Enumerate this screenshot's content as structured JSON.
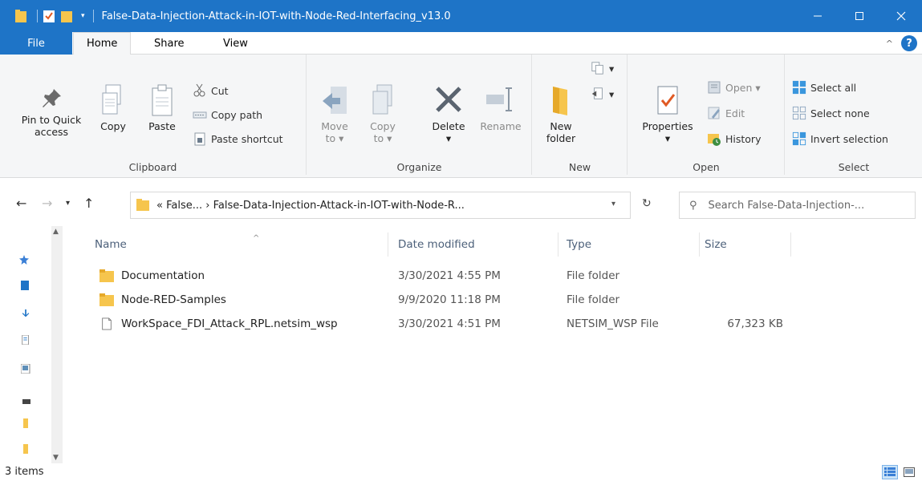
{
  "window": {
    "title": "False-Data-Injection-Attack-in-IOT-with-Node-Red-Interfacing_v13.0",
    "minimize": "—",
    "maximize": "☐",
    "close": "✕"
  },
  "ribbon_tabs": {
    "file": "File",
    "home": "Home",
    "share": "Share",
    "view": "View"
  },
  "clipboard": {
    "group": "Clipboard",
    "pin_line1": "Pin to Quick",
    "pin_line2": "access",
    "copy": "Copy",
    "paste": "Paste",
    "cut": "Cut",
    "copy_path": "Copy path",
    "paste_shortcut": "Paste shortcut"
  },
  "organize": {
    "group": "Organize",
    "move_to_1": "Move",
    "move_to_2": "to ▾",
    "copy_to_1": "Copy",
    "copy_to_2": "to ▾",
    "delete": "Delete",
    "delete_arrow": "▾",
    "rename": "Rename"
  },
  "new": {
    "group": "New",
    "new_folder_1": "New",
    "new_folder_2": "folder"
  },
  "open": {
    "group": "Open",
    "properties": "Properties",
    "properties_arrow": "▾",
    "open": "Open ▾",
    "edit": "Edit",
    "history": "History"
  },
  "select": {
    "group": "Select",
    "select_all": "Select all",
    "select_none": "Select none",
    "invert": "Invert selection"
  },
  "address": {
    "path": "« False...  ›  False-Data-Injection-Attack-in-IOT-with-Node-R...",
    "search_placeholder": "Search False-Data-Injection-..."
  },
  "columns": {
    "name": "Name",
    "date": "Date modified",
    "type": "Type",
    "size": "Size"
  },
  "files": [
    {
      "name": "Documentation",
      "date": "3/30/2021 4:55 PM",
      "type": "File folder",
      "size": ""
    },
    {
      "name": "Node-RED-Samples",
      "date": "9/9/2020 11:18 PM",
      "type": "File folder",
      "size": ""
    },
    {
      "name": "WorkSpace_FDI_Attack_RPL.netsim_wsp",
      "date": "3/30/2021 4:51 PM",
      "type": "NETSIM_WSP File",
      "size": "67,323 KB"
    }
  ],
  "status": {
    "items": "3 items"
  },
  "colors": {
    "accent": "#1e74c7",
    "folder": "#f6c54d",
    "ribbon_bg": "#f5f6f7"
  }
}
